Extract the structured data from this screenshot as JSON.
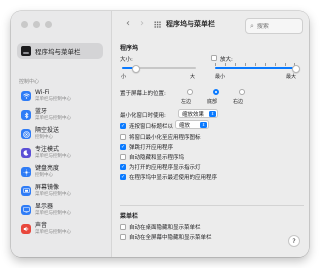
{
  "window": {
    "title": "程序坞与菜单栏"
  },
  "search": {
    "placeholder": "搜索"
  },
  "sidebar": {
    "selected_label": "程序坞与菜单栏",
    "section_label": "控制中心",
    "items": [
      {
        "title": "Wi-Fi",
        "sub": "菜单栏与控制中心",
        "icon": "wifi-icon",
        "color": "#2f7cf6"
      },
      {
        "title": "蓝牙",
        "sub": "菜单栏与控制中心",
        "icon": "bluetooth-icon",
        "color": "#2f7cf6"
      },
      {
        "title": "隔空投送",
        "sub": "控制中心",
        "icon": "airdrop-icon",
        "color": "#2f7cf6"
      },
      {
        "title": "专注模式",
        "sub": "菜单栏与控制中心",
        "icon": "moon-icon",
        "color": "#5b4fd6"
      },
      {
        "title": "键盘亮度",
        "sub": "控制中心",
        "icon": "keyboard-brightness-icon",
        "color": "#2f7cf6"
      },
      {
        "title": "屏幕镜像",
        "sub": "菜单栏与控制中心",
        "icon": "screen-mirroring-icon",
        "color": "#2f7cf6"
      },
      {
        "title": "显示器",
        "sub": "菜单栏与控制中心",
        "icon": "display-icon",
        "color": "#2f7cf6"
      },
      {
        "title": "声音",
        "sub": "菜单栏与控制中心",
        "icon": "sound-icon",
        "color": "#e8473c"
      }
    ]
  },
  "dock": {
    "heading": "程序坞",
    "size": {
      "label": "大小:",
      "min": "小",
      "max": "大",
      "value_fraction": 0.18
    },
    "magnify": {
      "label": "放大:",
      "min": "最小",
      "max": "最大",
      "value_fraction": 1.0,
      "checked": false
    },
    "position": {
      "label": "置于屏幕上的位置:",
      "options": [
        "左边",
        "底部",
        "右边"
      ],
      "selected": "底部"
    },
    "minimize": {
      "label": "最小化窗口时使用:",
      "value": "缩放效果"
    },
    "double_click": {
      "label": "连按窗口标题栏以",
      "value": "缩放",
      "checked": true
    },
    "options": [
      {
        "label": "将窗口最小化至应用程序图标",
        "checked": false
      },
      {
        "label": "弹跳打开应用程序",
        "checked": true
      },
      {
        "label": "自动隐藏和显示程序坞",
        "checked": false
      },
      {
        "label": "为打开的应用程序显示指示灯",
        "checked": true
      },
      {
        "label": "在程序坞中显示最近使用的应用程序",
        "checked": true
      }
    ]
  },
  "menubar": {
    "heading": "菜单栏",
    "options": [
      {
        "label": "自动在桌面隐藏和显示菜单栏",
        "checked": false
      },
      {
        "label": "自动在全屏幕中隐藏和显示菜单栏",
        "checked": false
      }
    ]
  },
  "help": {
    "label": "?"
  },
  "colors": {
    "accent": "#0a7aff"
  }
}
